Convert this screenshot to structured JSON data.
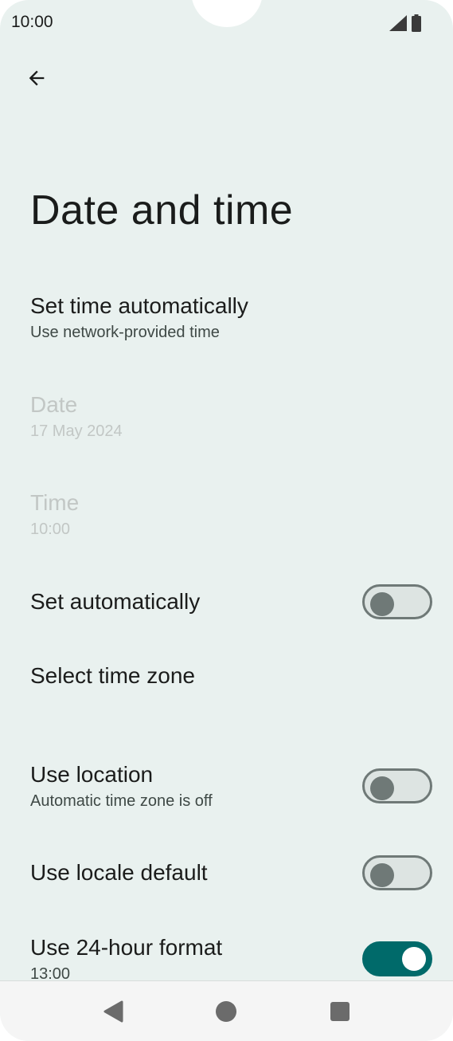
{
  "status_bar": {
    "time": "10:00",
    "icons": [
      "signal-icon",
      "battery-icon"
    ]
  },
  "header": {
    "back_icon": "arrow-back-icon",
    "title": "Date and time"
  },
  "settings": {
    "set_time_auto": {
      "title": "Set time automatically",
      "summary": "Use network-provided time"
    },
    "date": {
      "title": "Date",
      "summary": "17 May 2024",
      "enabled": false
    },
    "time": {
      "title": "Time",
      "summary": "10:00",
      "enabled": false
    },
    "set_auto": {
      "title": "Set automatically",
      "checked": false
    },
    "select_time_zone": {
      "title": "Select time zone"
    },
    "use_location": {
      "title": "Use location",
      "summary": "Automatic time zone is off",
      "checked": false
    },
    "use_locale_default": {
      "title": "Use locale default",
      "checked": false
    },
    "use_24_hour": {
      "title": "Use 24-hour format",
      "summary": "13:00",
      "checked": true
    }
  },
  "nav_bar": {
    "buttons": [
      "back-triangle-icon",
      "home-circle-icon",
      "recents-square-icon"
    ]
  },
  "colors": {
    "background": "#e9f1ef",
    "accent": "#006a6a",
    "disabled_text": "#c2c7c5",
    "toggle_off": "#6f7977"
  }
}
